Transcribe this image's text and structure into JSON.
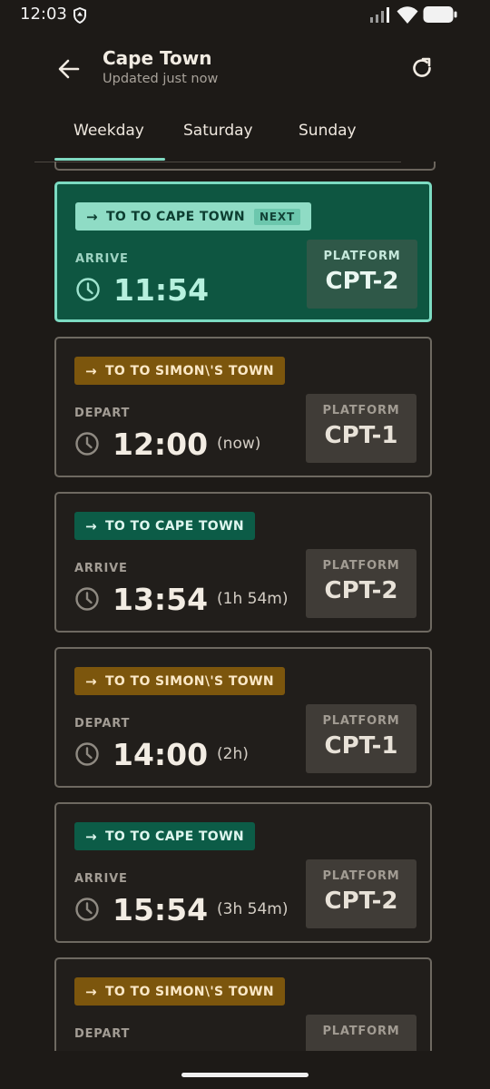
{
  "status_bar": {
    "time": "12:03",
    "icons": [
      "shield-icon",
      "signal-icon",
      "wifi-icon",
      "battery-icon"
    ]
  },
  "header": {
    "title": "Cape Town",
    "subtitle": "Updated just now",
    "back_icon": "arrow-left-icon",
    "refresh_icon": "refresh-icon"
  },
  "tabs": [
    {
      "label": "Weekday",
      "active": true
    },
    {
      "label": "Saturday",
      "active": false
    },
    {
      "label": "Sunday",
      "active": false
    }
  ],
  "colors": {
    "accent": "#7fd9c1",
    "next_card_bg": "#0e5641",
    "cape_badge": "#0c5c47",
    "simon_badge": "#7c560d",
    "background": "#1d1a17"
  },
  "trips": [
    {
      "destination": "TO TO CAPE TOWN",
      "next_tag": "NEXT",
      "direction": "ARRIVE",
      "time": "11:54",
      "relative": "",
      "platform_label": "PLATFORM",
      "platform": "CPT-2"
    },
    {
      "destination": "TO TO SIMON\\'S TOWN",
      "next_tag": "",
      "direction": "DEPART",
      "time": "12:00",
      "relative": "(now)",
      "platform_label": "PLATFORM",
      "platform": "CPT-1"
    },
    {
      "destination": "TO TO CAPE TOWN",
      "next_tag": "",
      "direction": "ARRIVE",
      "time": "13:54",
      "relative": "(1h 54m)",
      "platform_label": "PLATFORM",
      "platform": "CPT-2"
    },
    {
      "destination": "TO TO SIMON\\'S TOWN",
      "next_tag": "",
      "direction": "DEPART",
      "time": "14:00",
      "relative": "(2h)",
      "platform_label": "PLATFORM",
      "platform": "CPT-1"
    },
    {
      "destination": "TO TO CAPE TOWN",
      "next_tag": "",
      "direction": "ARRIVE",
      "time": "15:54",
      "relative": "(3h 54m)",
      "platform_label": "PLATFORM",
      "platform": "CPT-2"
    },
    {
      "destination": "TO TO SIMON\\'S TOWN",
      "next_tag": "",
      "direction": "DEPART",
      "time": "",
      "relative": "",
      "platform_label": "PLATFORM",
      "platform": ""
    }
  ]
}
